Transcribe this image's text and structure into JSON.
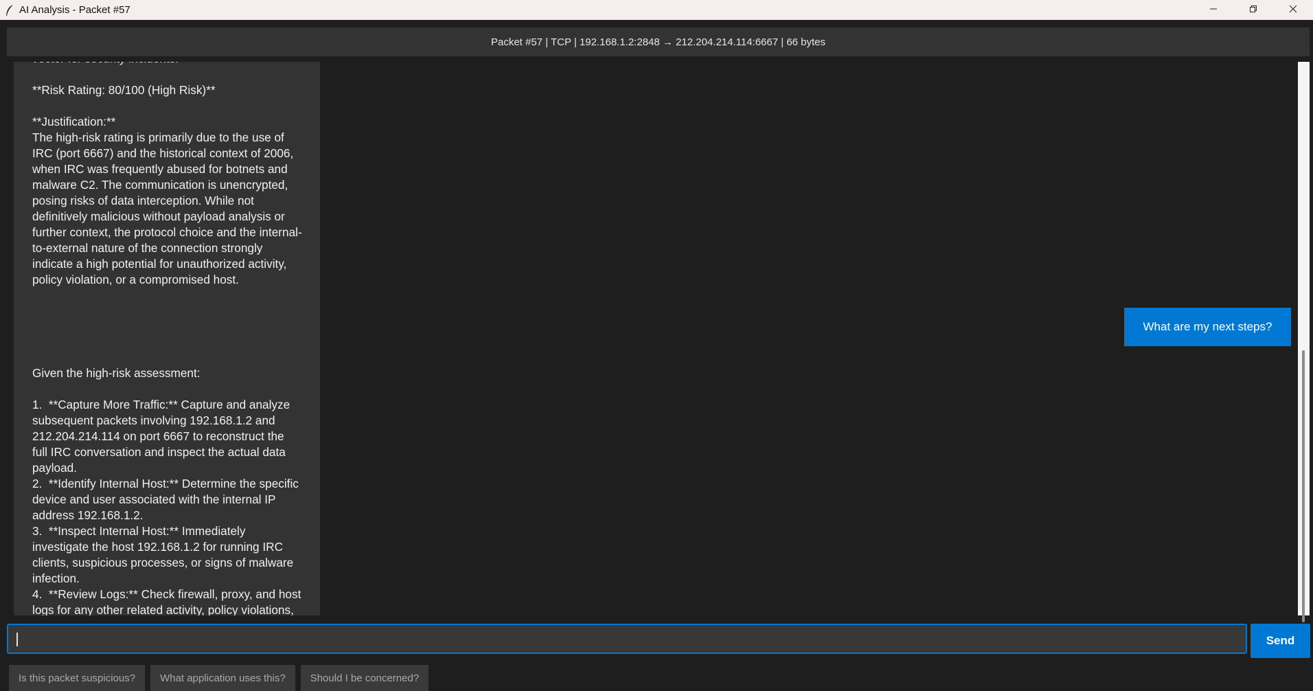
{
  "window": {
    "title": "AI Analysis - Packet #57",
    "icon": "feather-icon",
    "controls": [
      "minimize-icon",
      "restore-icon",
      "close-icon"
    ]
  },
  "header": {
    "packet_info": "Packet #57 | TCP | 192.168.1.2:2848 → 212.204.214.114:6667 | 66 bytes"
  },
  "messages": [
    {
      "role": "assistant",
      "text": "vector for security incidents.\n\n**Risk Rating: 80/100 (High Risk)**\n\n**Justification:**\nThe high-risk rating is primarily due to the use of IRC (port 6667) and the historical context of 2006, when IRC was frequently abused for botnets and malware C2. The communication is unencrypted, posing risks of data interception. While not definitively malicious without payload analysis or further context, the protocol choice and the internal-to-external nature of the connection strongly indicate a high potential for unauthorized activity, policy violation, or a compromised host."
    },
    {
      "role": "user",
      "text": "What are my next steps?"
    },
    {
      "role": "assistant",
      "text": "Given the high-risk assessment:\n\n1.  **Capture More Traffic:** Capture and analyze subsequent packets involving 192.168.1.2 and 212.204.214.114 on port 6667 to reconstruct the full IRC conversation and inspect the actual data payload.\n2.  **Identify Internal Host:** Determine the specific device and user associated with the internal IP address 192.168.1.2.\n3.  **Inspect Internal Host:** Immediately investigate the host 192.168.1.2 for running IRC clients, suspicious processes, or signs of malware infection.\n4.  **Review Logs:** Check firewall, proxy, and host logs for any other related activity, policy violations,"
    }
  ],
  "input": {
    "value": "",
    "placeholder": ""
  },
  "send_label": "Send",
  "suggestions": [
    "Is this packet suspicious?",
    "What application uses this?",
    "Should I be concerned?"
  ],
  "colors": {
    "accent": "#0078d4",
    "background": "#1e1e1e",
    "bubble": "#333333"
  }
}
